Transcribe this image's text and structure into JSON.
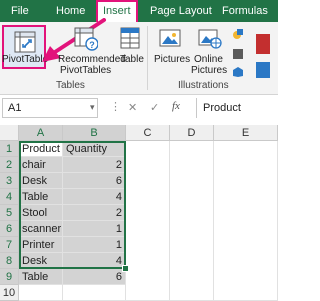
{
  "tabs": {
    "file": "File",
    "home": "Home",
    "insert": "Insert",
    "page_layout": "Page Layout",
    "formulas": "Formulas"
  },
  "ribbon": {
    "pivot_table": "PivotTable",
    "recommended_line1": "Recommended",
    "recommended_line2": "PivotTables",
    "table": "Table",
    "pictures": "Pictures",
    "online_line1": "Online",
    "online_line2": "Pictures",
    "group_tables": "Tables",
    "group_illustrations": "Illustrations"
  },
  "formula_bar": {
    "name_box": "A1",
    "fx": "fx",
    "content": "Product"
  },
  "grid": {
    "columns": [
      "A",
      "B",
      "C",
      "D",
      "E"
    ],
    "rows": [
      "1",
      "2",
      "3",
      "4",
      "5",
      "6",
      "7",
      "8",
      "9",
      "10"
    ],
    "header": {
      "product": "Product",
      "quantity": "Quantity"
    },
    "data": [
      {
        "product": "chair",
        "quantity": "2"
      },
      {
        "product": "Desk",
        "quantity": "6"
      },
      {
        "product": "Table",
        "quantity": "4"
      },
      {
        "product": "Stool",
        "quantity": "2"
      },
      {
        "product": "scanner",
        "quantity": "1"
      },
      {
        "product": "Printer",
        "quantity": "1"
      },
      {
        "product": "Desk",
        "quantity": "4"
      },
      {
        "product": "Table",
        "quantity": "6"
      }
    ]
  },
  "colors": {
    "excel_green": "#217346",
    "highlight_pink": "#e2137b",
    "selection_fill": "#d3d3d3"
  }
}
